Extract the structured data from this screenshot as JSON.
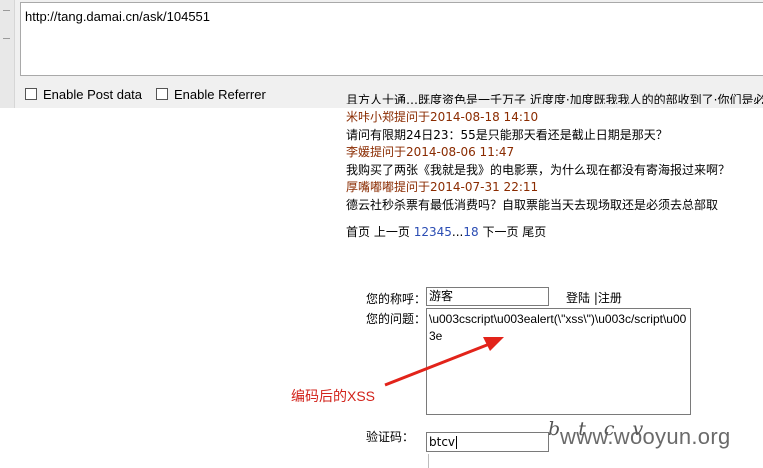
{
  "request": {
    "url": "http://tang.damai.cn/ask/104551",
    "enable_post_label": "Enable Post data",
    "enable_referrer_label": "Enable Referrer"
  },
  "questions": {
    "clipped_top_text": "且方人十通…既度资色是一千万子 近度度·加度既我我人的的部收到了·你们是必了",
    "items": [
      {
        "meta": "米咔小郑提问于2014-08-18 14:10",
        "question": "请问有限期24日23：55是只能那天看还是截止日期是那天？"
      },
      {
        "meta": "李媛提问于2014-08-06 11:47",
        "question": "我购买了两张《我就是我》的电影票，为什么现在都没有寄海报过来啊？"
      },
      {
        "meta": "厚嘴嘟嘟提问于2014-07-31 22:11",
        "question": "德云社秒杀票有最低消费吗？自取票能当天去现场取还是必须去总部取"
      }
    ]
  },
  "pager": {
    "first": "首页",
    "prev": "上一页",
    "pages": [
      "1",
      "2",
      "3",
      "4",
      "5"
    ],
    "ellipsis": "...",
    "last_num": "18",
    "next": "下一页",
    "last": "尾页"
  },
  "form": {
    "nickname_label": "您的称呼：",
    "nickname_value": "游客",
    "login_link": "登陆",
    "separator": "|",
    "register_link": "注册",
    "question_label": "您的问题：",
    "question_value": "\\u003cscript\\u003ealert(\\\"xss\\\")\\u003c/script\\u003e",
    "code_label": "验证码：",
    "code_value": "btcv",
    "captcha_text": "b t c v"
  },
  "annotation": {
    "text": "编码后的XSS",
    "color": "#d2231b"
  },
  "watermark": {
    "text": "www.wooyun.org"
  }
}
